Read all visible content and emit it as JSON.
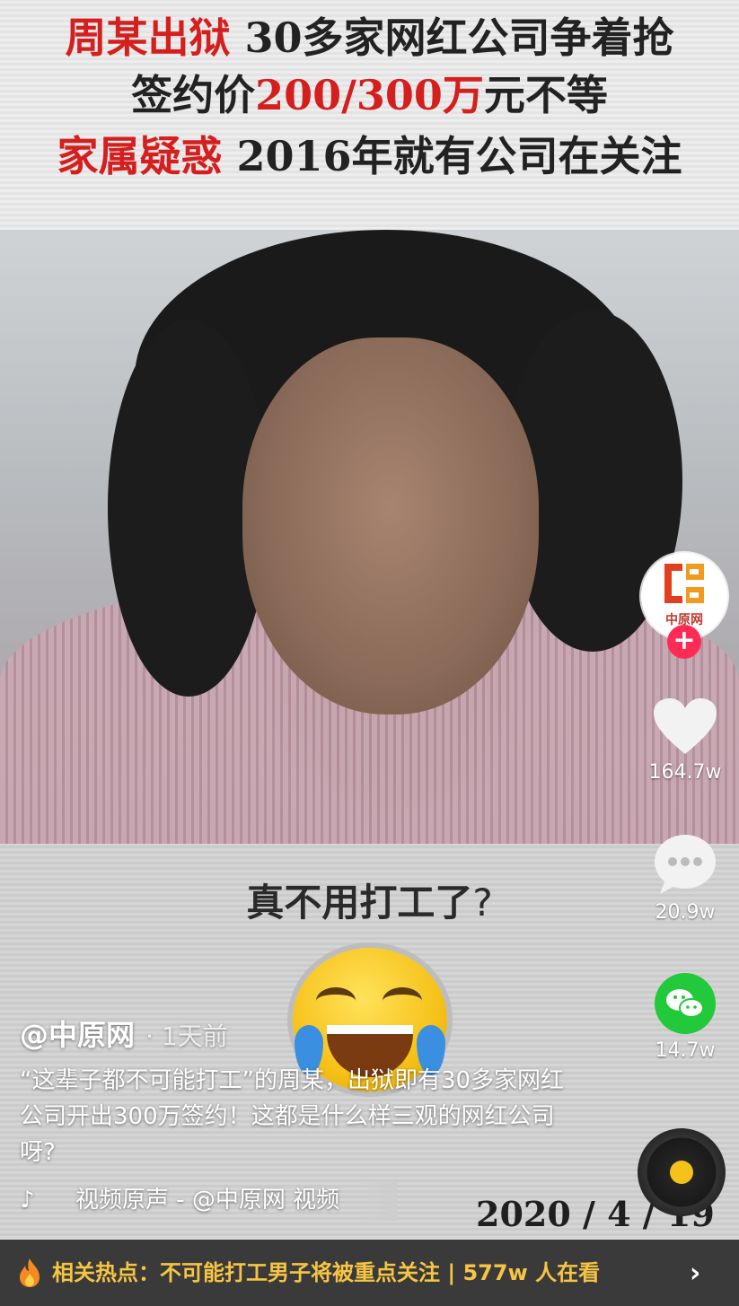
{
  "banner": {
    "line1_red": "周某出狱",
    "line1_rest": " 30多家网红公司争着抢",
    "line2_pre": "签约价",
    "line2_red": "200/300万",
    "line2_post": "元不等",
    "line3_red": "家属疑惑",
    "line3_rest": "  2016年就有公司在关注"
  },
  "caption": {
    "text": "真不用打工了",
    "mark": "?"
  },
  "date_stamp": "2020 / 4 / 19",
  "rail": {
    "avatar_text": "中原网",
    "follow_symbol": "+",
    "like_count": "164.7w",
    "comment_count": "20.9w",
    "share_count": "14.7w"
  },
  "post": {
    "author": "@中原网",
    "time": "· 1天前",
    "description": "“这辈子都不可能打工”的周某，出狱即有30多家网红公司开出300万签约！这都是什么样三观的网红公司呀?",
    "music": "视频原声 - @中原网    视频"
  },
  "hotbar": {
    "text": "相关热点：不可能打工男子将被重点关注  | 577w 人在看",
    "arrow": "›"
  },
  "colors": {
    "headline_red": "#d51f1f",
    "follow_pink": "#fe2c55",
    "wechat_green": "#22c93a",
    "hot_yellow": "#f6c544"
  }
}
